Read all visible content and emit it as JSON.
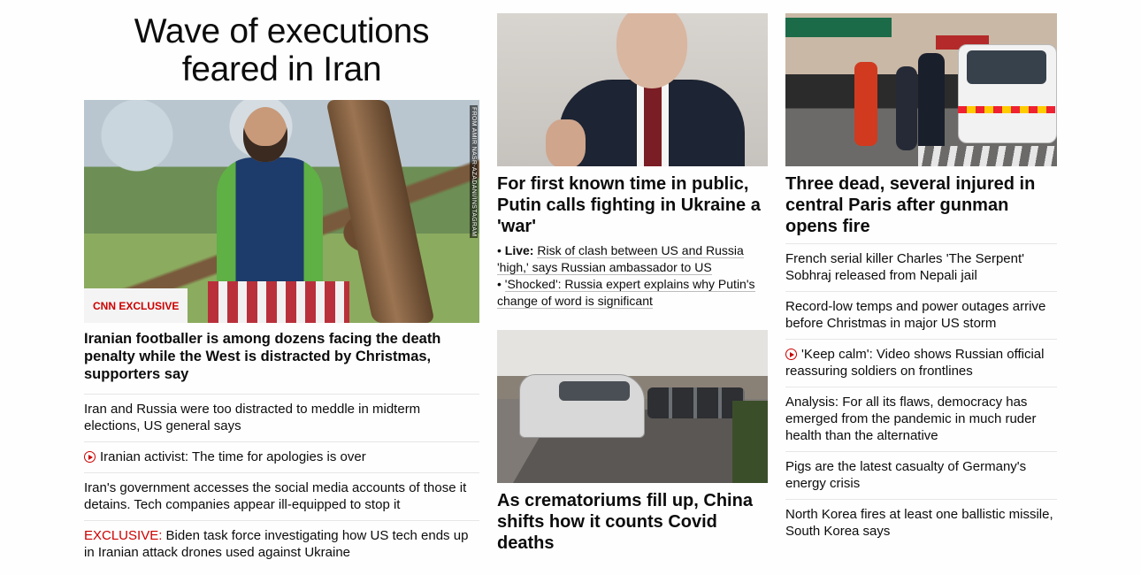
{
  "lead": {
    "title": "Wave of executions feared in Iran",
    "badge": "CNN EXCLUSIVE",
    "photo_credit": "FROM AMIR NASR-AZADANI/INSTAGRAM",
    "caption": "Iranian footballer is among dozens facing the death penalty while the West is distracted by Christmas, supporters say",
    "items": [
      {
        "text": "Iran and Russia were too distracted to meddle in midterm elections, US general says"
      },
      {
        "text": "Iranian activist: The time for apologies is over",
        "icon": "play-icon"
      },
      {
        "text": "Iran's government accesses the social media accounts of those it detains. Tech companies appear ill-equipped to stop it"
      },
      {
        "prefix": "EXCLUSIVE:",
        "text": " Biden task force investigating how US tech ends up in Iranian attack drones used against Ukraine"
      }
    ]
  },
  "middle": {
    "story1": {
      "headline": "For first known time in public, Putin calls fighting in Ukraine a 'war'",
      "sub_links": [
        {
          "prefix": "Live:",
          "text": "Risk of clash between US and Russia 'high,' says Russian ambassador to US"
        },
        {
          "text": "'Shocked': Russia expert explains why Putin's change of word is significant"
        }
      ]
    },
    "story2": {
      "headline": "As crematoriums fill up, China shifts how it counts Covid deaths"
    }
  },
  "right": {
    "headline": "Three dead, several injured in central Paris after gunman opens fire",
    "items": [
      {
        "text": "French serial killer Charles 'The Serpent' Sobhraj released from Nepali jail"
      },
      {
        "text": "Record-low temps and power outages arrive before Christmas in major US storm"
      },
      {
        "text": "'Keep calm': Video shows Russian official reassuring soldiers on frontlines",
        "icon": "play-icon"
      },
      {
        "text": "Analysis: For all its flaws, democracy has emerged from the pandemic in much ruder health than the alternative"
      },
      {
        "text": "Pigs are the latest casualty of Germany's energy crisis"
      },
      {
        "text": "North Korea fires at least one ballistic missile, South Korea says"
      }
    ]
  },
  "colors": {
    "accent": "#cc0000",
    "divider": "#e6e6e6"
  }
}
